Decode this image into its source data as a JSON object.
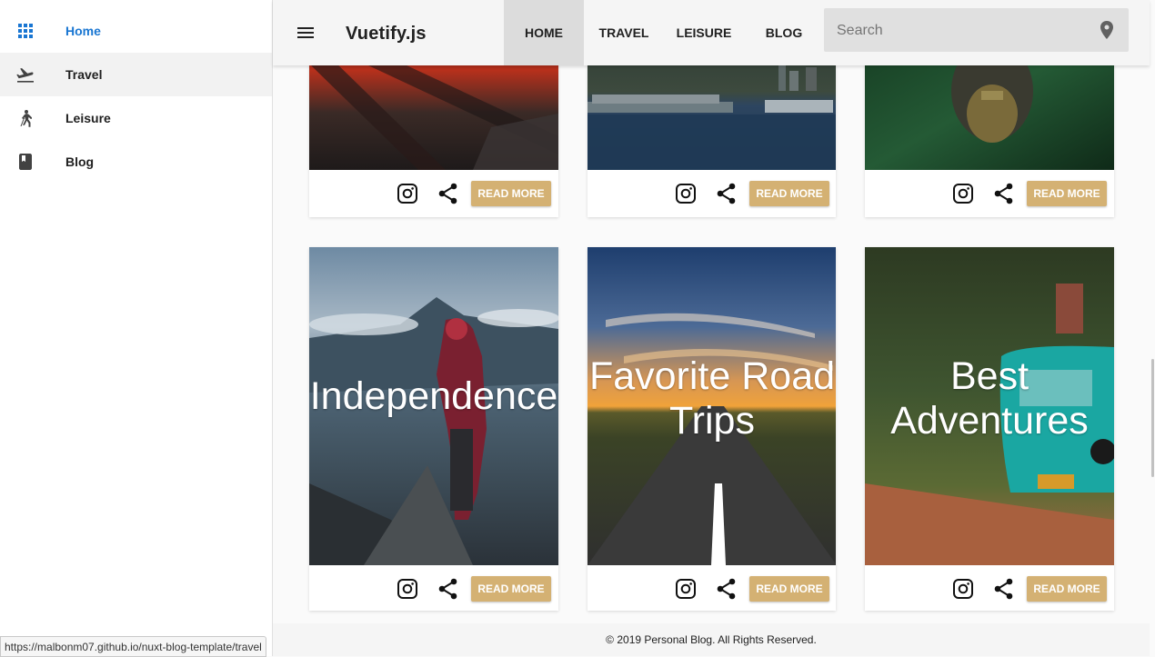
{
  "sidebar": {
    "items": [
      {
        "label": "Home",
        "icon": "apps-grid-icon"
      },
      {
        "label": "Travel",
        "icon": "flight-takeoff-icon"
      },
      {
        "label": "Leisure",
        "icon": "hiking-icon"
      },
      {
        "label": "Blog",
        "icon": "book-icon"
      }
    ]
  },
  "toolbar": {
    "brand": "Vuetify.js",
    "nav": [
      "HOME",
      "TRAVEL",
      "LEISURE",
      "BLOG"
    ],
    "search_placeholder": "Search"
  },
  "cards": {
    "read_more": "READ MORE",
    "titles": [
      "Independence",
      "Favorite Road Trips",
      "Best Adventures"
    ]
  },
  "footer": {
    "copyright": "© 2019 Personal Blog. All Rights Reserved."
  },
  "status_bar": {
    "url": "https://malbonm07.github.io/nuxt-blog-template/travel"
  },
  "colors": {
    "accent": "#1976d2",
    "button": "#d4b173",
    "toolbar": "#f5f5f5"
  }
}
